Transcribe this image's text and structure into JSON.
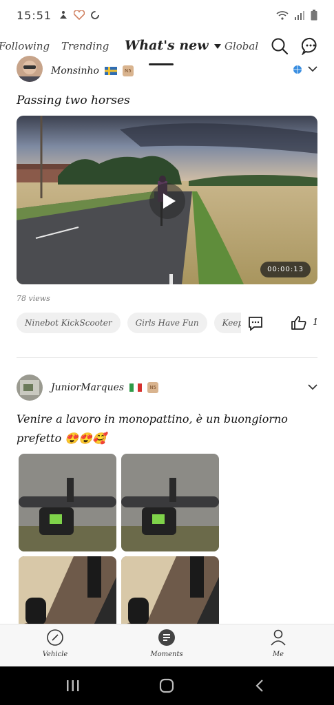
{
  "status_bar": {
    "time": "15:51",
    "icons_left": [
      "person-yoga-icon",
      "heart-health-icon",
      "sync-icon"
    ],
    "icons_right": [
      "wifi-icon",
      "signal-icon",
      "battery-icon"
    ]
  },
  "top_nav": {
    "tabs": [
      {
        "label": "Following"
      },
      {
        "label": "Trending"
      },
      {
        "label": "What's new"
      },
      {
        "label": "Global"
      }
    ],
    "active_index": 2,
    "icons": [
      "search-icon",
      "message-icon"
    ]
  },
  "post1": {
    "author": "Monsinho",
    "flag": "Sweden",
    "level": "N5",
    "title": "Passing two horses",
    "video_duration": "00:00:13",
    "views": "78 views",
    "tags": [
      "Ninebot KickScooter",
      "Girls Have Fun",
      "Keep Mov"
    ],
    "like_count": "1"
  },
  "post2": {
    "author": "JuniorMarques",
    "flag": "Italy",
    "level": "N5",
    "text": "Venire a lavoro in monopattino, è un buongiorno prefetto 😍😍🥰",
    "image_count": 4
  },
  "bottom_nav": {
    "items": [
      {
        "label": "Vehicle",
        "icon": "compass-icon"
      },
      {
        "label": "Moments",
        "icon": "moments-icon"
      },
      {
        "label": "Me",
        "icon": "person-icon"
      }
    ],
    "active_index": 1
  },
  "colors": {
    "accent": "#222222",
    "background": "#ffffff",
    "tag_bg": "#f0f0f0",
    "nav_bg": "#f7f7f7"
  }
}
